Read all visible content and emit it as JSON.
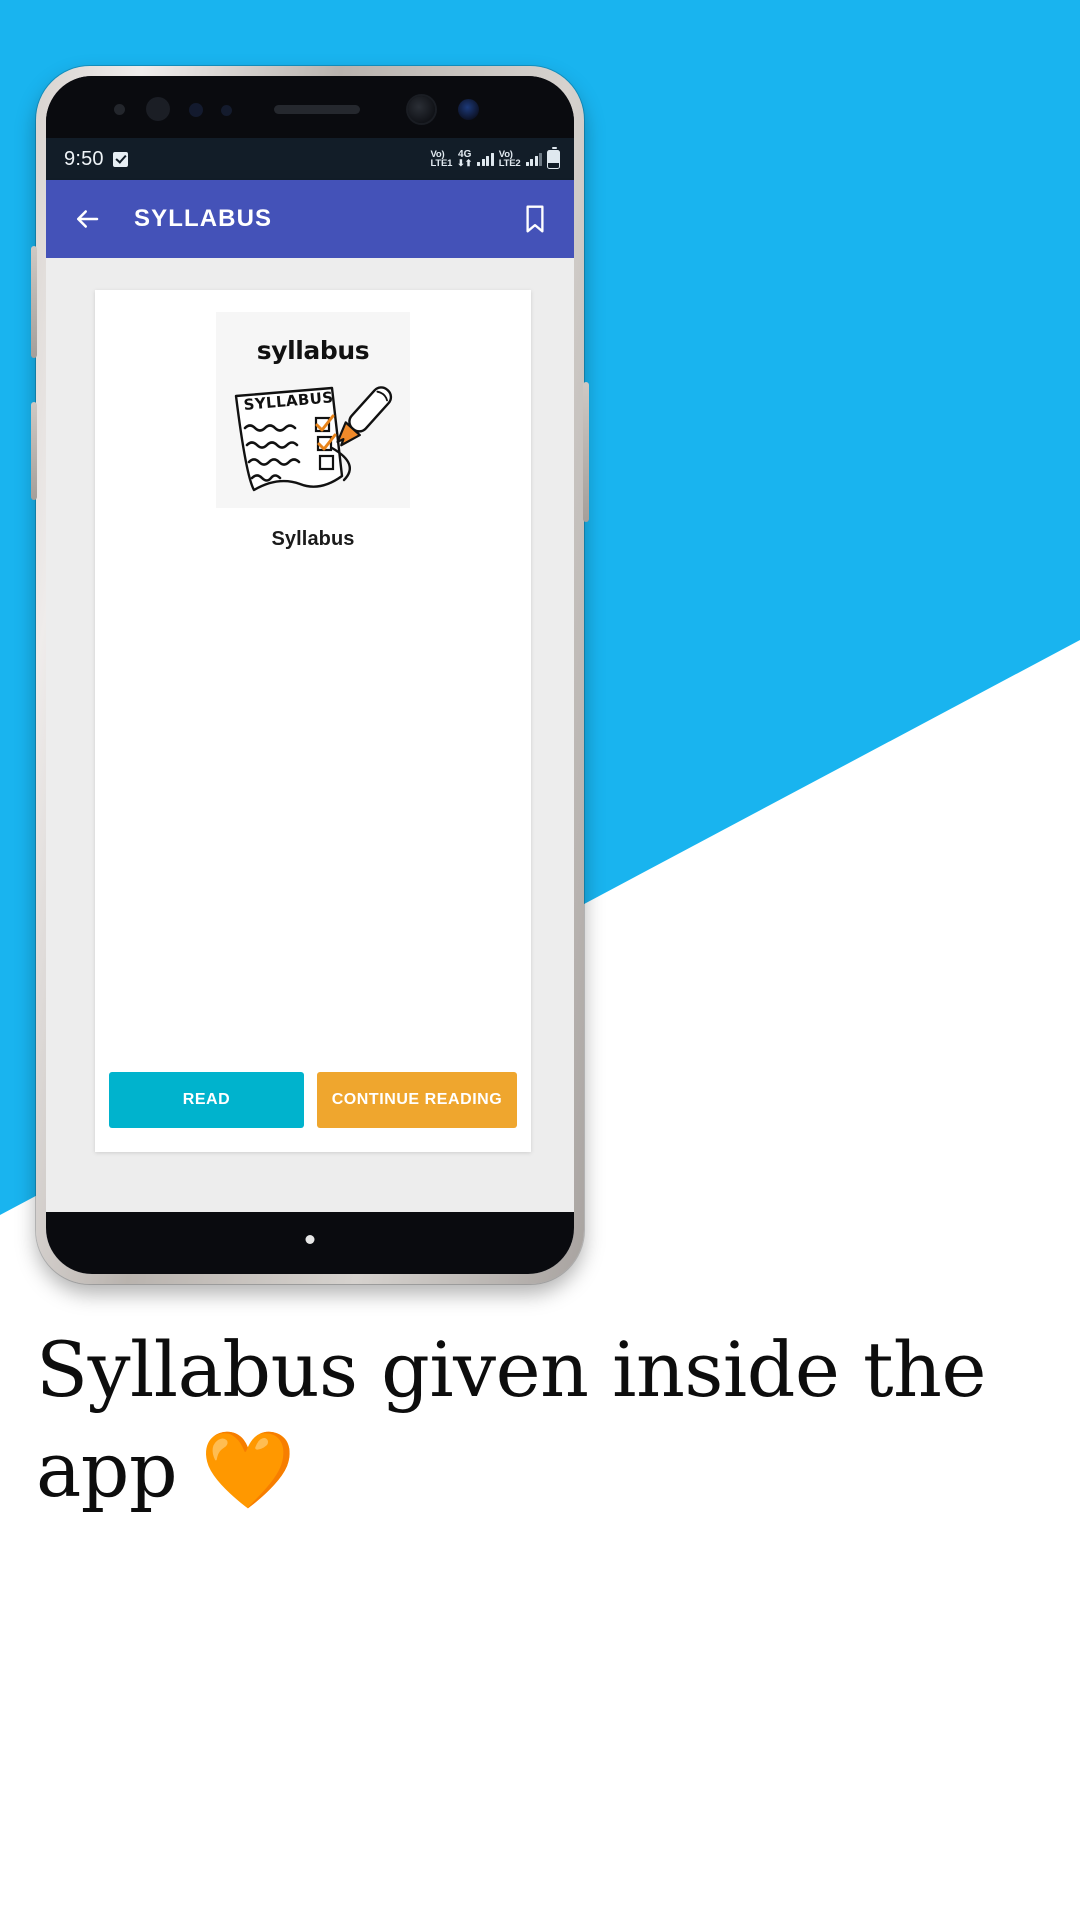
{
  "background": {
    "accent_color": "#19B4EF"
  },
  "status_bar": {
    "time": "9:50",
    "check_icon": "checkbox-checked-icon",
    "sim1_volte_top": "Vo)",
    "sim1_volte_bottom": "LTE1",
    "network_type": "4G",
    "data_arrows": "⬇⬆",
    "sim2_volte_top": "Vo)",
    "sim2_volte_bottom": "LTE2",
    "battery_icon": "battery-icon",
    "background_color": "#121D28"
  },
  "app_bar": {
    "back_icon": "back-arrow-icon",
    "title": "SYLLABUS",
    "bookmark_icon": "bookmark-icon",
    "background_color": "#4452B8"
  },
  "content": {
    "card": {
      "cover_word": "syllabus",
      "cover_art": "syllabus-checklist-pen-illustration",
      "book_title": "Syllabus",
      "buttons": [
        {
          "label": "READ",
          "color": "#00B3CD",
          "name": "read-button"
        },
        {
          "label": "CONTINUE READING",
          "color": "#EFA62E",
          "name": "continue-reading-button"
        }
      ]
    }
  },
  "phone": {
    "home_indicator": "home-dot"
  },
  "caption": {
    "line1": "Syllabus given inside the",
    "line2": "app ",
    "emoji": "🧡"
  }
}
